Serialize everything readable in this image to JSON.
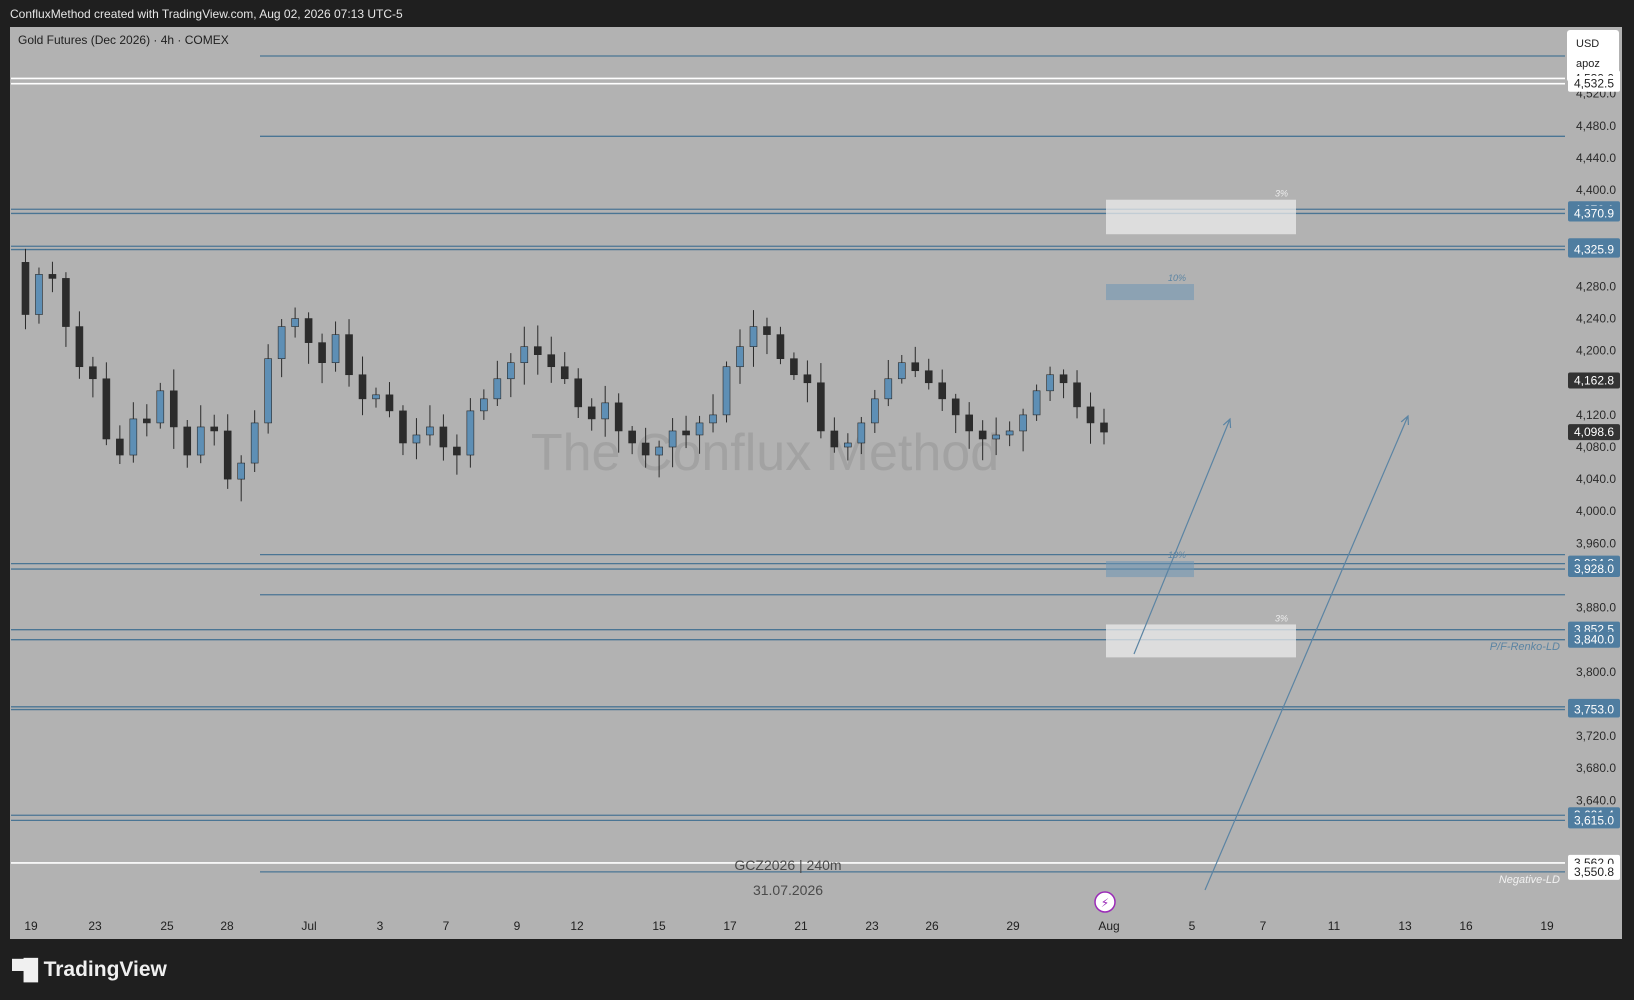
{
  "header": {
    "creator_line": "ConfluxMethod created with TradingView.com, Aug 02, 2026 07:13 UTC-5"
  },
  "chart_header": {
    "symbol_line": "Gold Futures (Dec 2026) · 4h · COMEX"
  },
  "badge": {
    "currency": "USD",
    "user": "apoz"
  },
  "watermark": "The Conflux Method",
  "footer_info": {
    "ticker": "GCZ2026 | 240m",
    "date": "31.07.2026"
  },
  "brand": {
    "name": "TradingView"
  },
  "colors": {
    "background": "#b2b2b2",
    "outer": "#1f1f1f",
    "level_line": "#4a7594",
    "bull": "#5e8fb5",
    "bear": "#2c2c2c",
    "price_label_blue": "#4f7da0",
    "price_label_dark": "#333333"
  },
  "chart_data": {
    "type": "candlestick",
    "timeframe": "4h",
    "ylim": [
      3532,
      4567
    ],
    "y_ticks": [
      "4,520.0",
      "4,480.0",
      "4,440.0",
      "4,400.0",
      "4,280.0",
      "4,240.0",
      "4,200.0",
      "4,120.0",
      "4,080.0",
      "4,040.0",
      "4,000.0",
      "3,960.0",
      "3,880.0",
      "3,800.0",
      "3,760.0",
      "3,720.0",
      "3,680.0",
      "3,640.0"
    ],
    "x_ticks": [
      "19",
      "23",
      "25",
      "28",
      "Jul",
      "3",
      "7",
      "9",
      "12",
      "15",
      "17",
      "21",
      "23",
      "26",
      "29",
      "Aug",
      "5",
      "7",
      "11",
      "13",
      "16",
      "19"
    ],
    "close_path": [
      4310,
      4245,
      4295,
      4290,
      4230,
      4180,
      4165,
      4090,
      4070,
      4115,
      4110,
      4150,
      4105,
      4070,
      4105,
      4100,
      4040,
      4060,
      4110,
      4190,
      4230,
      4240,
      4210,
      4185,
      4220,
      4170,
      4140,
      4145,
      4125,
      4085,
      4095,
      4105,
      4080,
      4070,
      4125,
      4140,
      4165,
      4185,
      4205,
      4195,
      4180,
      4165,
      4130,
      4115,
      4135,
      4100,
      4085,
      4070,
      4080,
      4100,
      4095,
      4110,
      4120,
      4180,
      4205,
      4230,
      4220,
      4190,
      4170,
      4160,
      4100,
      4080,
      4085,
      4110,
      4140,
      4165,
      4185,
      4175,
      4160,
      4140,
      4120,
      4100,
      4090,
      4095,
      4100,
      4120,
      4150,
      4170,
      4160,
      4130,
      4110,
      4098.6
    ],
    "price_labels": [
      {
        "text": "4,539.0",
        "style": "white"
      },
      {
        "text": "4,532.5",
        "style": "white"
      },
      {
        "text": "4,376.1",
        "style": "blue"
      },
      {
        "text": "4,370.9",
        "style": "blue"
      },
      {
        "text": "4,330.0",
        "style": "blue"
      },
      {
        "text": "4,325.9",
        "style": "blue"
      },
      {
        "text": "4,162.8",
        "style": "dark"
      },
      {
        "text": "4,098.6",
        "style": "dark"
      },
      {
        "text": "3,934.8",
        "style": "blue"
      },
      {
        "text": "3,928.0",
        "style": "blue"
      },
      {
        "text": "3,852.5",
        "style": "blue"
      },
      {
        "text": "3,840.0",
        "style": "blue"
      },
      {
        "text": "3,756.4",
        "style": "blue"
      },
      {
        "text": "3,753.0",
        "style": "blue"
      },
      {
        "text": "3,621.4",
        "style": "blue"
      },
      {
        "text": "3,615.0",
        "style": "blue"
      },
      {
        "text": "3,562.0",
        "style": "white"
      },
      {
        "text": "3,550.8",
        "style": "white"
      }
    ],
    "horizontal_levels": [
      {
        "value": 4567,
        "color": "#4a7594",
        "partial": true
      },
      {
        "value": 4539.0,
        "color": "#ffffff"
      },
      {
        "value": 4532.5,
        "color": "#ffffff"
      },
      {
        "value": 4467,
        "color": "#4a7594",
        "partial": true
      },
      {
        "value": 4376.1,
        "color": "#4a7594"
      },
      {
        "value": 4370.9,
        "color": "#4a7594"
      },
      {
        "value": 4330.0,
        "color": "#4a7594"
      },
      {
        "value": 4325.9,
        "color": "#4a7594"
      },
      {
        "value": 3946,
        "color": "#4a7594",
        "partial": true
      },
      {
        "value": 3934.8,
        "color": "#4a7594"
      },
      {
        "value": 3928.0,
        "color": "#4a7594"
      },
      {
        "value": 3896,
        "color": "#4a7594",
        "partial": true
      },
      {
        "value": 3852.5,
        "color": "#4a7594"
      },
      {
        "value": 3840.0,
        "color": "#4a7594"
      },
      {
        "value": 3756.4,
        "color": "#4a7594"
      },
      {
        "value": 3753.0,
        "color": "#4a7594"
      },
      {
        "value": 3621.4,
        "color": "#4a7594"
      },
      {
        "value": 3615.0,
        "color": "#4a7594"
      },
      {
        "value": 3562.0,
        "color": "#ffffff"
      },
      {
        "value": 3550.8,
        "color": "#4a7594",
        "partial": true
      }
    ],
    "zones": [
      {
        "label": "3%",
        "top": 4388,
        "bottom": 4345,
        "style": "white"
      },
      {
        "label": "10%",
        "top": 4283,
        "bottom": 4263,
        "style": "blue"
      },
      {
        "label": "10%",
        "top": 3938,
        "bottom": 3918,
        "style": "blue"
      },
      {
        "label": "3%",
        "top": 3859,
        "bottom": 3818,
        "style": "white"
      }
    ],
    "level_labels": [
      "P/F-Renko-LD",
      "Negative-LD"
    ]
  }
}
